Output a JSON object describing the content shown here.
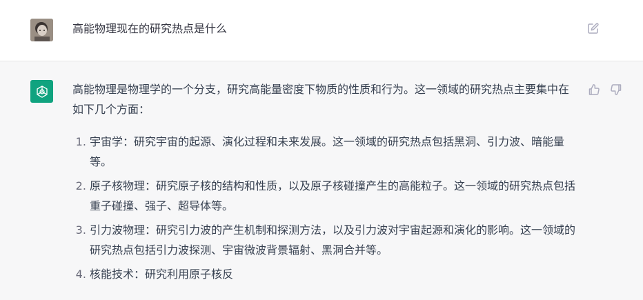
{
  "user_message": {
    "text": "高能物理现在的研究热点是什么",
    "avatar_icon": "user-avatar-photo",
    "edit_icon": "edit-icon"
  },
  "assistant_message": {
    "intro": "高能物理是物理学的一个分支，研究高能量密度下物质的性质和行为。这一领域的研究热点主要集中在如下几个方面：",
    "items": [
      "宇宙学：研究宇宙的起源、演化过程和未来发展。这一领域的研究热点包括黑洞、引力波、暗能量等。",
      "原子核物理：研究原子核的结构和性质，以及原子核碰撞产生的高能粒子。这一领域的研究热点包括重子碰撞、强子、超导体等。",
      "引力波物理：研究引力波的产生机制和探测方法，以及引力波对宇宙起源和演化的影响。这一领域的研究热点包括引力波探测、宇宙微波背景辐射、黑洞合并等。",
      "核能技术：研究利用原子核反"
    ],
    "avatar_icon": "openai-logo-icon",
    "feedback_icons": [
      "thumbs-up-icon",
      "thumbs-down-icon"
    ],
    "brand_color": "#10a37f"
  }
}
